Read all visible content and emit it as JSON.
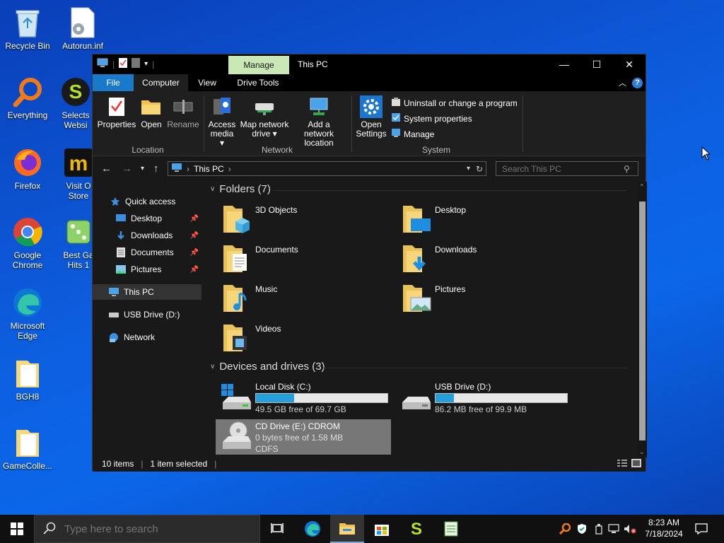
{
  "desktop": {
    "icons": [
      {
        "label": "Recycle Bin"
      },
      {
        "label": "Autorun.inf"
      },
      {
        "label": "Everything"
      },
      {
        "label": "Selects Websi"
      },
      {
        "label": "Firefox"
      },
      {
        "label": "Visit O Store"
      },
      {
        "label": "Google Chrome"
      },
      {
        "label": "Best Ga Hits 1"
      },
      {
        "label": "Microsoft Edge"
      },
      {
        "label": "BGH8"
      },
      {
        "label": "GameColle..."
      }
    ]
  },
  "window": {
    "title": "This PC",
    "contextual_tab": "Manage",
    "tabs": [
      {
        "label": "File"
      },
      {
        "label": "Computer"
      },
      {
        "label": "View"
      },
      {
        "label": "Drive Tools"
      }
    ],
    "ribbon": {
      "location": {
        "label": "Location",
        "buttons": [
          "Properties",
          "Open",
          "Rename"
        ]
      },
      "network": {
        "label": "Network",
        "access_media": [
          "Access",
          "media ▾"
        ],
        "map_network_drive": [
          "Map network",
          "drive ▾"
        ],
        "add_network_location": [
          "Add a network",
          "location"
        ]
      },
      "system": {
        "label": "System",
        "open_settings": [
          "Open",
          "Settings"
        ],
        "uninstall": "Uninstall or change a program",
        "system_properties": "System properties",
        "manage": "Manage"
      }
    },
    "address": {
      "path": "This PC",
      "search_placeholder": "Search This PC"
    },
    "nav": {
      "quick_access": "Quick access",
      "items": [
        {
          "label": "Desktop"
        },
        {
          "label": "Downloads"
        },
        {
          "label": "Documents"
        },
        {
          "label": "Pictures"
        }
      ],
      "this_pc": "This PC",
      "usb": "USB Drive (D:)",
      "network": "Network"
    },
    "folders_header": "Folders (7)",
    "folders": [
      {
        "name": "3D Objects"
      },
      {
        "name": "Desktop"
      },
      {
        "name": "Documents"
      },
      {
        "name": "Downloads"
      },
      {
        "name": "Music"
      },
      {
        "name": "Pictures"
      },
      {
        "name": "Videos"
      }
    ],
    "devices_header": "Devices and drives (3)",
    "drives": [
      {
        "name": "Local Disk (C:)",
        "free": "49.5 GB free of 69.7 GB",
        "used_fraction": 0.29
      },
      {
        "name": "USB Drive (D:)",
        "free": "86.2 MB free of 99.9 MB",
        "used_fraction": 0.14
      },
      {
        "name": "CD Drive (E:) CDROM",
        "free": "0 bytes free of 1.58 MB",
        "fs": "CDFS"
      }
    ],
    "status": {
      "items": "10 items",
      "selected": "1 item selected"
    }
  },
  "taskbar": {
    "search_placeholder": "Type here to search",
    "time": "8:23 AM",
    "date": "7/18/2024"
  },
  "colors": {
    "accent": "#1979ca",
    "manage_tab": "#c9e8b6",
    "drive_bar": "#26a0da"
  }
}
